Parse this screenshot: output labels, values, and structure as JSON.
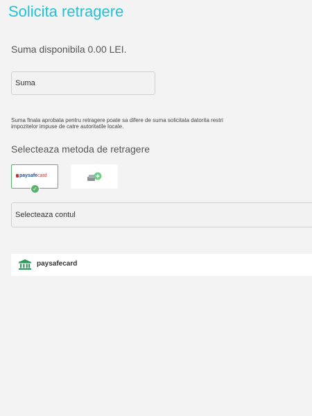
{
  "page": {
    "title": "Solicita retragere",
    "available_balance": "Suma disponibila 0.00 LEI."
  },
  "amount": {
    "placeholder": "Suma",
    "value": ""
  },
  "note": {
    "line1": "Suma finala aprobata pentru retragere poate sa difere de suma solicitata datorita restri",
    "line2": "impozitelor impuse de catre autoritatile locale."
  },
  "methods": {
    "heading": "Selecteaza metoda de retragere",
    "items": [
      {
        "name": "paysafecard",
        "logo_main": "paysafe",
        "logo_accent": "card",
        "selected": true
      },
      {
        "name": "cash",
        "icon": "cash-hand-icon",
        "selected": false
      }
    ]
  },
  "account": {
    "select_label": "Selecteaza contul",
    "option_label": "paysafecard",
    "option_icon": "bank-icon"
  },
  "colors": {
    "accent": "#22c2d6",
    "selected_border": "#58b36b",
    "bank_icon": "#2e9a5a"
  }
}
